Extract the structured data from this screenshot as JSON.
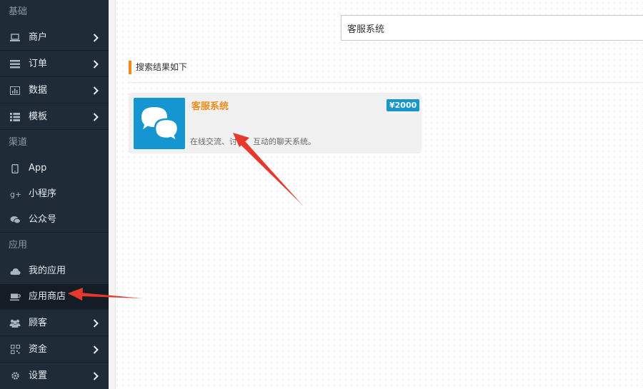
{
  "sidebar": {
    "groups": {
      "basic": "基础",
      "channel": "渠道",
      "apps": "应用"
    },
    "items": [
      {
        "label": "商户",
        "icon": "laptop-icon"
      },
      {
        "label": "订单",
        "icon": "list-icon"
      },
      {
        "label": "数据",
        "icon": "bar-chart-icon"
      },
      {
        "label": "模板",
        "icon": "grid-list-icon"
      },
      {
        "label": "App",
        "icon": "tablet-icon"
      },
      {
        "label": "小程序",
        "icon": "google-plus-icon"
      },
      {
        "label": "公众号",
        "icon": "chat-bubbles-icon"
      },
      {
        "label": "我的应用",
        "icon": "cloud-icon"
      },
      {
        "label": "应用商店",
        "icon": "coffee-cup-icon"
      },
      {
        "label": "顾客",
        "icon": "users-icon"
      },
      {
        "label": "资金",
        "icon": "qrcode-icon"
      },
      {
        "label": "设置",
        "icon": "gear-icon"
      }
    ]
  },
  "search": {
    "value": "客服系统"
  },
  "results": {
    "heading": "搜索结果如下",
    "cards": [
      {
        "title": "客服系统",
        "price": "¥2000",
        "description": "在线交流、讨论、互动的聊天系统。",
        "icon": "chat-bubbles-icon"
      }
    ]
  },
  "colors": {
    "sidebar_bg": "#1f2b36",
    "accent_orange": "#f08c1a",
    "accent_blue": "#1596d0",
    "annotation_red": "#e8382b"
  }
}
